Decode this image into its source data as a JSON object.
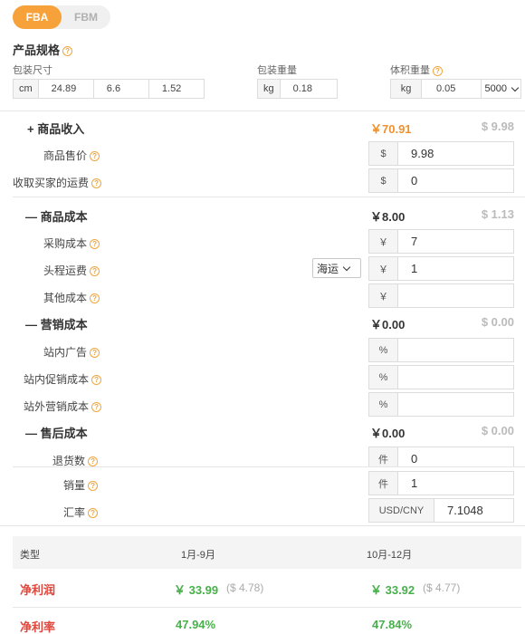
{
  "mode_toggle": {
    "active": "FBA",
    "inactive": "FBM"
  },
  "specs": {
    "title": "产品规格",
    "pkg_size": {
      "label": "包装尺寸",
      "unit": "cm",
      "l": "24.89",
      "w": "6.6",
      "h": "1.52"
    },
    "pkg_weight": {
      "label": "包装重量",
      "unit": "kg",
      "value": "0.18"
    },
    "vol_weight": {
      "label": "体积重量",
      "unit": "kg",
      "value": "0.05",
      "divisor": "5000"
    }
  },
  "revenue": {
    "title": "商品收入",
    "total_cny": "￥70.91",
    "total_usd": "$ 9.98",
    "expander": "+",
    "price": {
      "label": "商品售价",
      "currency": "$",
      "value": "9.98"
    },
    "shipping_charge": {
      "label": "收取买家的运费",
      "currency": "$",
      "value": "0"
    }
  },
  "product_cost": {
    "title": "商品成本",
    "total_cny": "￥8.00",
    "total_usd": "$ 1.13",
    "expander": "—",
    "purchase": {
      "label": "采购成本",
      "currency": "￥",
      "value": "7"
    },
    "first_leg": {
      "label": "头程运费",
      "currency": "￥",
      "value": "1",
      "method": "海运"
    },
    "other": {
      "label": "其他成本",
      "currency": "￥",
      "value": ""
    }
  },
  "marketing_cost": {
    "title": "营销成本",
    "total_cny": "￥0.00",
    "total_usd": "$ 0.00",
    "expander": "—",
    "onsite_ads": {
      "label": "站内广告",
      "unit": "%",
      "value": ""
    },
    "onsite_promo": {
      "label": "站内促销成本",
      "unit": "%",
      "value": ""
    },
    "offsite": {
      "label": "站外营销成本",
      "unit": "%",
      "value": ""
    }
  },
  "after_sales": {
    "title": "售后成本",
    "total_cny": "￥0.00",
    "total_usd": "$ 0.00",
    "expander": "—",
    "returns": {
      "label": "退货数",
      "unit": "件",
      "value": "0"
    }
  },
  "sales": {
    "label": "销量",
    "unit": "件",
    "value": "1"
  },
  "exchange": {
    "label": "汇率",
    "currency_pair": "USD/CNY",
    "value": "7.1048"
  },
  "results": {
    "headers": [
      "类型",
      "1月-9月",
      "10月-12月"
    ],
    "net_profit": {
      "label": "净利润",
      "p1_cny": "￥ 33.99",
      "p1_usd": "($ 4.78)",
      "p2_cny": "￥ 33.92",
      "p2_usd": "($ 4.77)"
    },
    "net_margin": {
      "label": "净利率",
      "p1": "47.94%",
      "p2": "47.84%"
    }
  },
  "colors": {
    "accent": "#f6a13a",
    "profit_label": "#e0463b",
    "positive": "#47b04b"
  }
}
